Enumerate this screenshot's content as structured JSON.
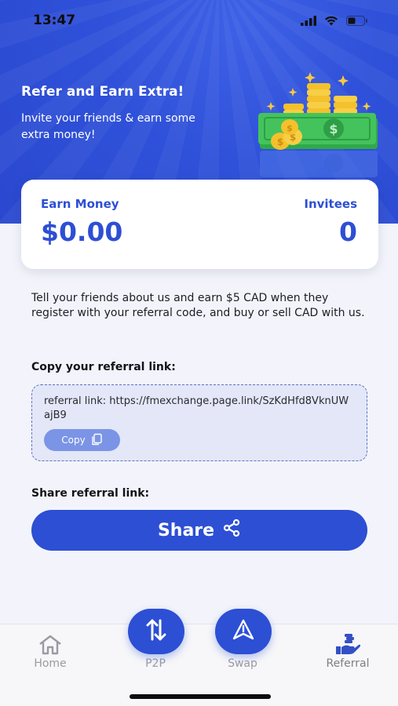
{
  "status_bar": {
    "time": "13:47",
    "icons": [
      "cellular-signal-icon",
      "wifi-icon",
      "battery-icon"
    ]
  },
  "hero": {
    "title": "Refer and Earn Extra!",
    "subtitle": "Invite your friends & earn some extra money!",
    "illustration": "money-stack-illustration"
  },
  "stats": {
    "earn_label": "Earn Money",
    "earn_value": "$0.00",
    "invitees_label": "Invitees",
    "invitees_value": "0"
  },
  "description": "Tell your friends about us and earn $5 CAD when they register with your referral code, and buy or sell CAD with us.",
  "referral": {
    "copy_heading": "Copy your referral link:",
    "link_text": "referral link: https://fmexchange.page.link/SzKdHfd8VknUWajB9",
    "copy_label": "Copy",
    "share_heading": "Share referral link:",
    "share_label": "Share"
  },
  "tab_bar": {
    "items": [
      {
        "label": "Home",
        "icon": "home-icon"
      },
      {
        "label": "P2P",
        "icon": "swap-arrows-icon"
      },
      {
        "label": "Swap",
        "icon": "navigation-arrow-icon"
      },
      {
        "label": "Referral",
        "icon": "referral-hand-icon"
      }
    ]
  },
  "colors": {
    "primary": "#2c4fd4",
    "hero_bg": "#2f51d9",
    "copy_button": "#7b94e6",
    "link_box_bg": "#e3e7f7",
    "page_bg": "#f3f4fb"
  }
}
